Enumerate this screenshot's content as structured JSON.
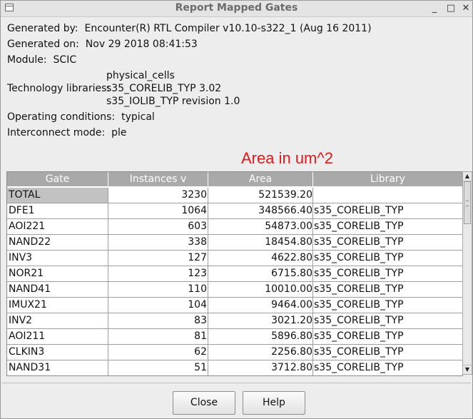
{
  "window": {
    "title": "Report Mapped Gates",
    "controls": {
      "minimize": "_",
      "maximize": "□",
      "close": "✕"
    }
  },
  "info": {
    "generated_by_label": "Generated by:",
    "generated_by_value": "Encounter(R) RTL Compiler v10.10-s322_1 (Aug 16 2011)",
    "generated_on_label": "Generated on:",
    "generated_on_value": "Nov 29 2018  08:41:53",
    "module_label": "Module:",
    "module_value": "SCIC",
    "tech_libs_label": "Technology libraries:",
    "tech_libs": [
      "physical_cells",
      "s35_CORELIB_TYP 3.02",
      "s35_IOLIB_TYP revision 1.0"
    ],
    "operating_conditions_label": "Operating conditions:",
    "operating_conditions_value": "typical",
    "interconnect_label": "Interconnect mode:",
    "interconnect_value": "ple"
  },
  "annotation": "Area in um^2",
  "table": {
    "columns": [
      "Gate",
      "Instances v",
      "Area",
      "Library"
    ],
    "rows": [
      [
        "TOTAL",
        "3230",
        "521539.20",
        ""
      ],
      [
        "DFE1",
        "1064",
        "348566.40",
        "s35_CORELIB_TYP"
      ],
      [
        "AOI221",
        "603",
        "54873.00",
        "s35_CORELIB_TYP"
      ],
      [
        "NAND22",
        "338",
        "18454.80",
        "s35_CORELIB_TYP"
      ],
      [
        "INV3",
        "127",
        "4622.80",
        "s35_CORELIB_TYP"
      ],
      [
        "NOR21",
        "123",
        "6715.80",
        "s35_CORELIB_TYP"
      ],
      [
        "NAND41",
        "110",
        "10010.00",
        "s35_CORELIB_TYP"
      ],
      [
        "IMUX21",
        "104",
        "9464.00",
        "s35_CORELIB_TYP"
      ],
      [
        "INV2",
        "83",
        "3021.20",
        "s35_CORELIB_TYP"
      ],
      [
        "AOI211",
        "81",
        "5896.80",
        "s35_CORELIB_TYP"
      ],
      [
        "CLKIN3",
        "62",
        "2256.80",
        "s35_CORELIB_TYP"
      ],
      [
        "NAND31",
        "51",
        "3712.80",
        "s35_CORELIB_TYP"
      ]
    ]
  },
  "buttons": {
    "close": "Close",
    "help": "Help"
  },
  "colors": {
    "annotation": "#e0191b",
    "header_bg": "#a9a9a9"
  }
}
